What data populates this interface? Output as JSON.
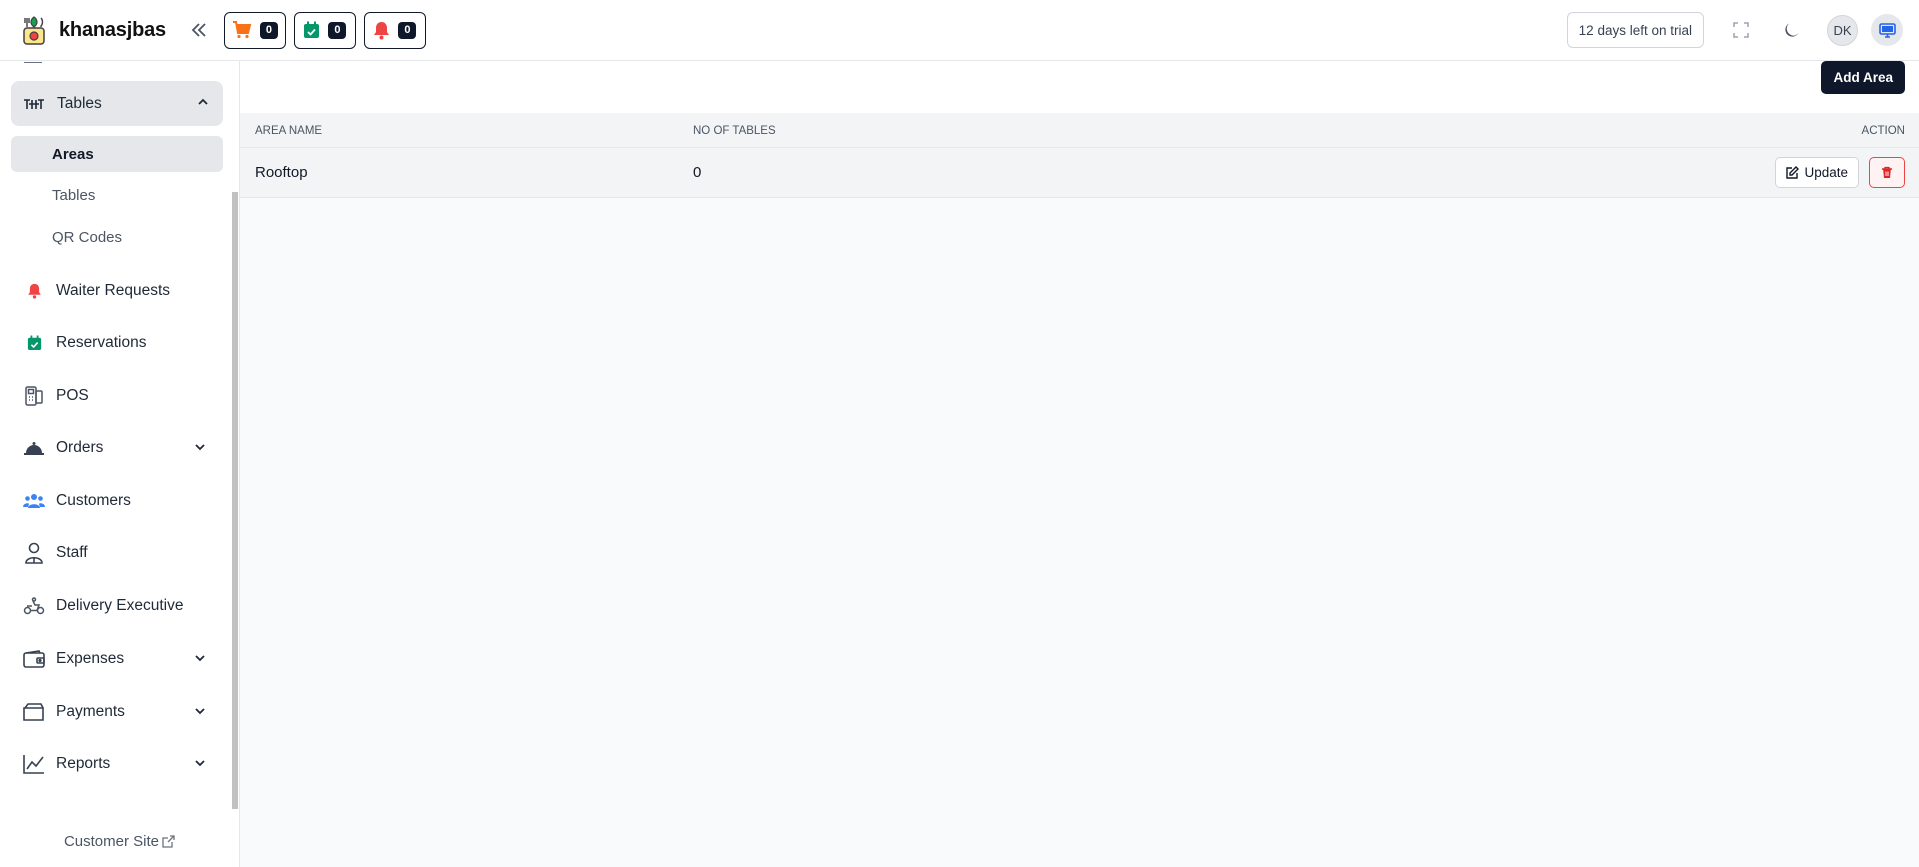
{
  "header": {
    "brand_name": "khanasjbas",
    "counters": [
      {
        "name": "orders",
        "icon": "cart-icon",
        "color": "#f97316",
        "count": "0"
      },
      {
        "name": "reservations",
        "icon": "calendar-check-icon",
        "color": "#059669",
        "count": "0"
      },
      {
        "name": "waiter-requests",
        "icon": "bell-icon",
        "color": "#ef4444",
        "count": "0"
      }
    ],
    "trial_text": "12 days left on trial",
    "avatar_initials": "DK"
  },
  "sidebar": {
    "open_group": {
      "label": "Tables",
      "icon": "table-icon"
    },
    "sub_items": [
      {
        "label": "Areas",
        "active": true
      },
      {
        "label": "Tables",
        "active": false
      },
      {
        "label": "QR Codes",
        "active": false
      }
    ],
    "items": [
      {
        "label": "Waiter Requests",
        "icon": "bell-icon",
        "has_chevron": false
      },
      {
        "label": "Reservations",
        "icon": "calendar-check-icon",
        "has_chevron": false
      },
      {
        "label": "POS",
        "icon": "pos-icon",
        "has_chevron": false
      },
      {
        "label": "Orders",
        "icon": "cloche-icon",
        "has_chevron": true
      },
      {
        "label": "Customers",
        "icon": "users-icon",
        "has_chevron": false
      },
      {
        "label": "Staff",
        "icon": "user-icon",
        "has_chevron": false
      },
      {
        "label": "Delivery Executive",
        "icon": "scooter-icon",
        "has_chevron": false
      },
      {
        "label": "Expenses",
        "icon": "wallet-icon",
        "has_chevron": true
      },
      {
        "label": "Payments",
        "icon": "folder-icon",
        "has_chevron": true
      },
      {
        "label": "Reports",
        "icon": "chart-line-icon",
        "has_chevron": true
      }
    ],
    "footer_link": "Customer Site"
  },
  "main": {
    "add_button": "Add Area",
    "columns": [
      "Area Name",
      "No of Tables",
      "Action"
    ],
    "rows": [
      {
        "area_name": "Rooftop",
        "no_of_tables": "0"
      }
    ],
    "update_label": "Update"
  },
  "colors": {
    "primary_dark": "#0f172a",
    "danger": "#ef4444",
    "accent_blue": "#2563eb"
  }
}
